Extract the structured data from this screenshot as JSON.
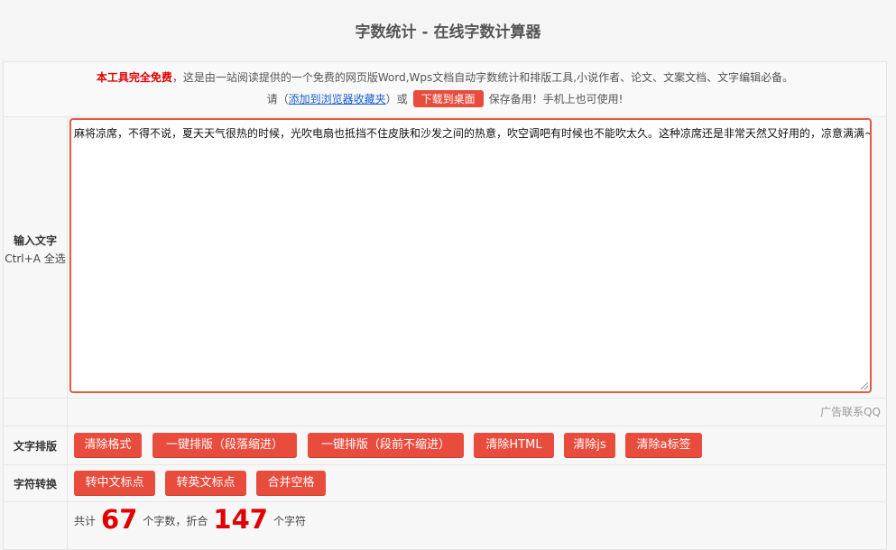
{
  "page": {
    "title": "字数统计 - 在线字数计算器"
  },
  "notice": {
    "free_label": "本工具完全免费",
    "line1_rest": "，这是由一站阅读提供的一个免费的网页版Word,Wps文档自动字数统计和排版工具,小说作者、论文、文案文档、文字编辑必备。",
    "line2_prefix": "请（",
    "bookmark_link": "添加到浏览器收藏夹",
    "line2_mid": "）或",
    "download_button": "下载到桌面",
    "line2_suffix": "保存备用！手机上也可使用!"
  },
  "input": {
    "label": "输入文字",
    "hint": "Ctrl+A 全选",
    "text": "麻将凉席，不得不说，夏天天气很热的时候，光吹电扇也抵挡不住皮肤和沙发之间的热意，吹空调吧有时候也不能吹太久。这种凉席还是非常天然又好用的，凉意满满~"
  },
  "ad": {
    "text": "广告联系QQ"
  },
  "layout_section": {
    "label": "文字排版",
    "buttons": [
      "清除格式",
      "一键排版（段落缩进）",
      "一键排版（段前不缩进）",
      "清除HTML",
      "清除js",
      "清除a标签"
    ]
  },
  "convert_section": {
    "label": "字符转换",
    "buttons": [
      "转中文标点",
      "转英文标点",
      "合并空格"
    ]
  },
  "stats": {
    "prefix": "共计",
    "char_count": "67",
    "char_unit": "个字数，折合",
    "byte_count": "147",
    "byte_unit": "个字符"
  },
  "colors": {
    "accent": "#e84c3d",
    "highlight": "#e00000",
    "link": "#1a5fd0"
  }
}
